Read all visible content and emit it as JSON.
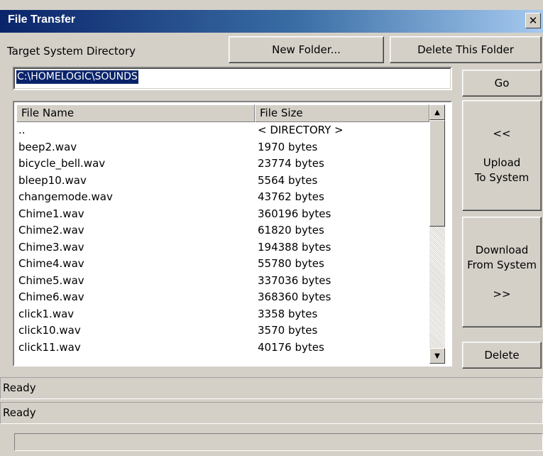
{
  "window": {
    "title": "File Transfer",
    "close_glyph": "✕"
  },
  "toolbar": {
    "target_label": "Target System Directory",
    "new_folder": "New Folder...",
    "delete_folder": "Delete This Folder"
  },
  "path": {
    "value": "C:\\HOMELOGIC\\SOUNDS"
  },
  "buttons": {
    "go": "Go",
    "upload_arrows": "<<",
    "upload_line1": "Upload",
    "upload_line2": "To System",
    "download_line1": "Download",
    "download_line2": "From System",
    "download_arrows": ">>",
    "delete": "Delete"
  },
  "list": {
    "columns": [
      "File Name",
      "File Size"
    ],
    "rows": [
      {
        "name": "..",
        "size": "< DIRECTORY >"
      },
      {
        "name": "beep2.wav",
        "size": "1970 bytes"
      },
      {
        "name": "bicycle_bell.wav",
        "size": "23774 bytes"
      },
      {
        "name": "bleep10.wav",
        "size": "5564 bytes"
      },
      {
        "name": "changemode.wav",
        "size": "43762 bytes"
      },
      {
        "name": "Chime1.wav",
        "size": "360196 bytes"
      },
      {
        "name": "Chime2.wav",
        "size": "61820 bytes"
      },
      {
        "name": "Chime3.wav",
        "size": "194388 bytes"
      },
      {
        "name": "Chime4.wav",
        "size": "55780 bytes"
      },
      {
        "name": "Chime5.wav",
        "size": "337036 bytes"
      },
      {
        "name": "Chime6.wav",
        "size": "368360 bytes"
      },
      {
        "name": "click1.wav",
        "size": "3358 bytes"
      },
      {
        "name": "click10.wav",
        "size": "3570 bytes"
      },
      {
        "name": "click11.wav",
        "size": "40176 bytes"
      }
    ],
    "scroll_up_glyph": "▲",
    "scroll_down_glyph": "▼"
  },
  "status": {
    "line1": "Ready",
    "line2": "Ready",
    "line3": ""
  }
}
